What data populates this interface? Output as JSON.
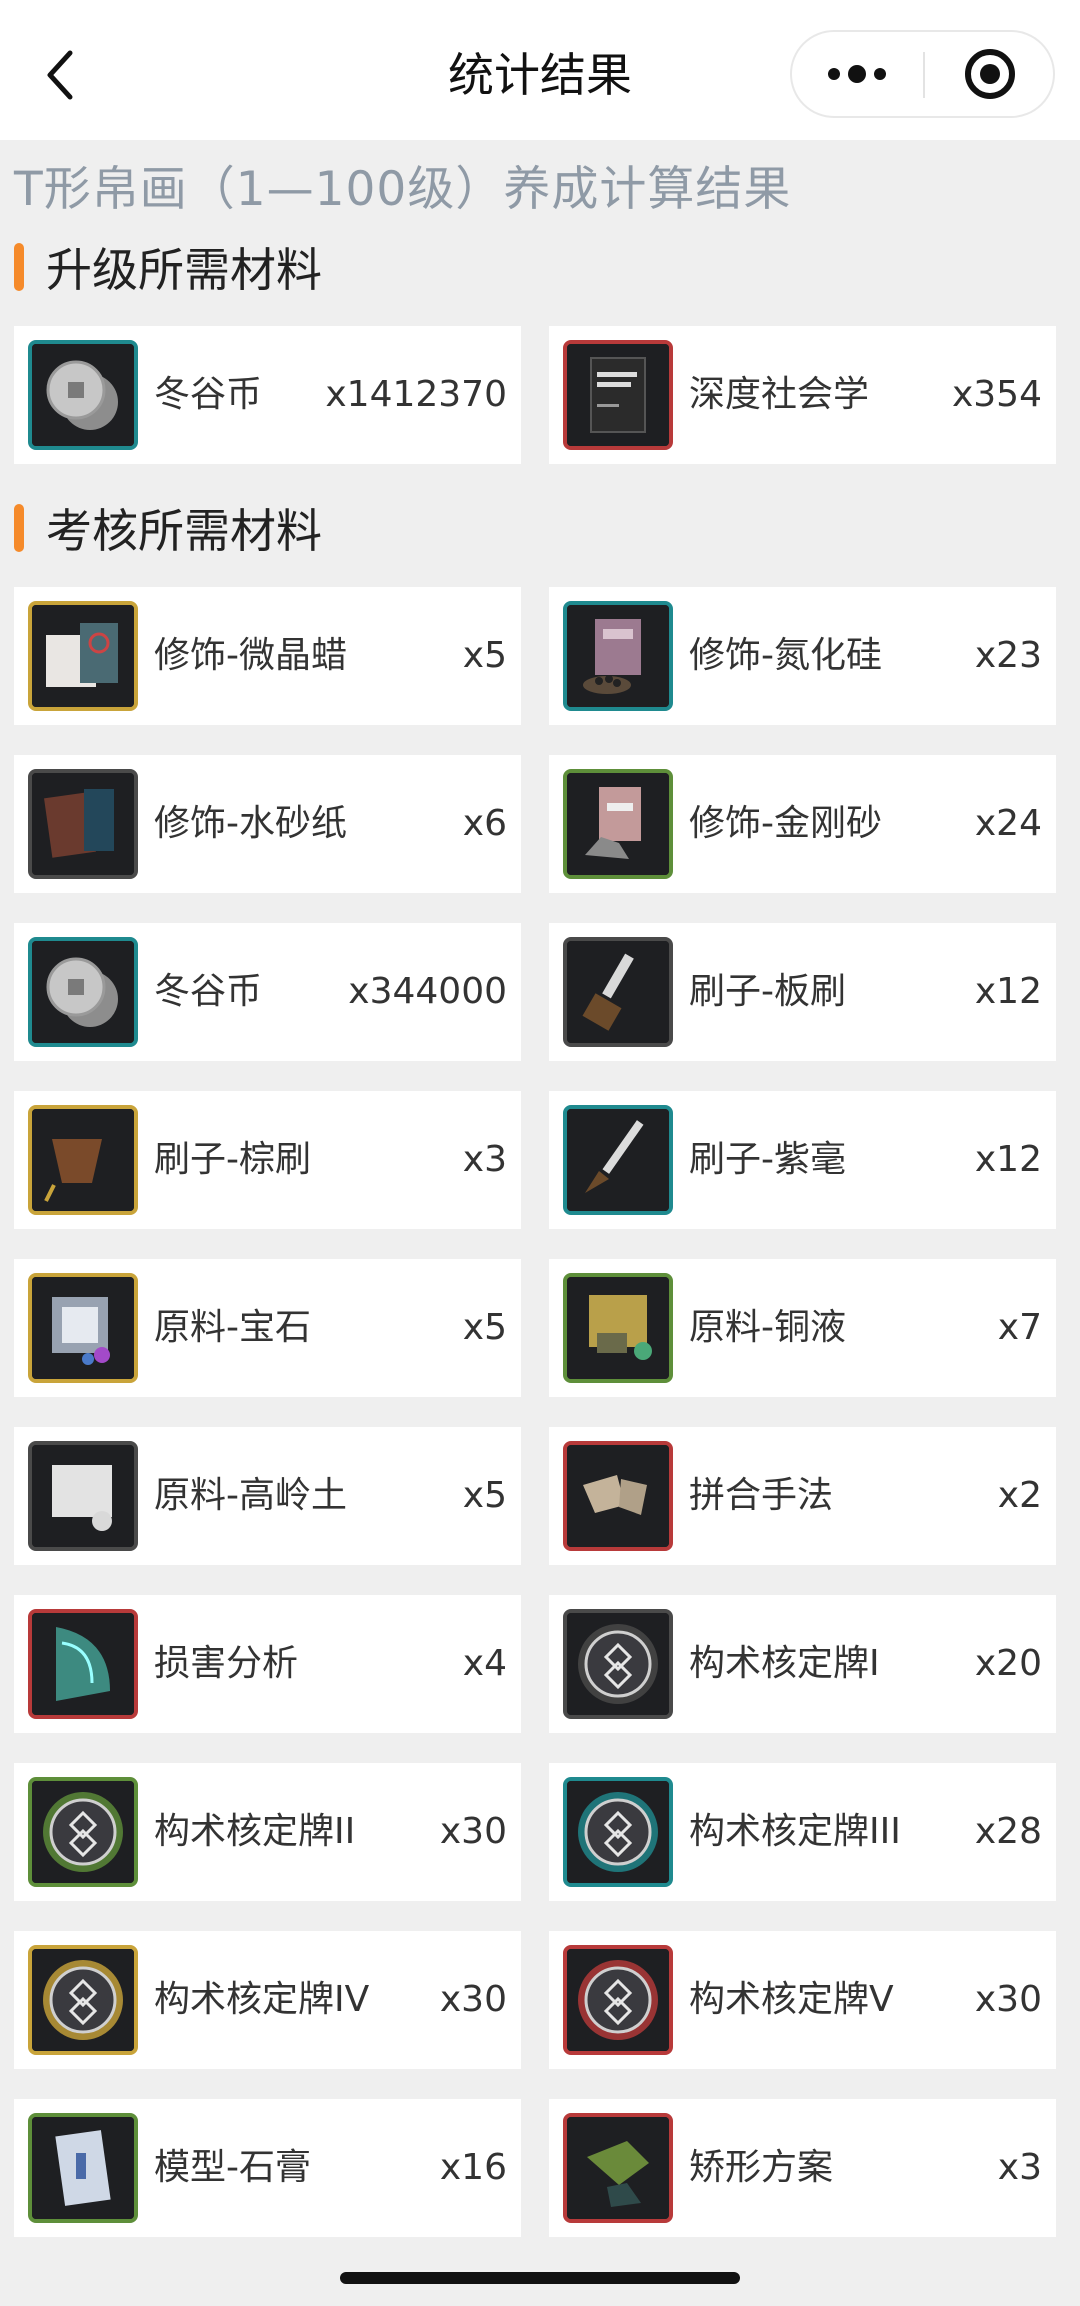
{
  "nav": {
    "title": "统计结果",
    "back_icon": "chevron-left-icon",
    "more_icon": "more-dots-icon",
    "close_icon": "target-close-icon"
  },
  "page_heading": "T形帛画（1—100级）养成计算结果",
  "colors": {
    "accent": "#f58a2a",
    "heading": "#8f9aa6",
    "frame_gold": "#c9a43a",
    "frame_teal": "#1f8a8f",
    "frame_red": "#b83a3a",
    "frame_green": "#5e8f3a",
    "frame_gray": "#4a4a4a"
  },
  "sections": [
    {
      "title": "升级所需材料",
      "items": [
        {
          "name": "冬谷币",
          "qty": "x1412370",
          "frame": "teal",
          "icon": "coin-icon"
        },
        {
          "name": "深度社会学",
          "qty": "x354",
          "frame": "red",
          "icon": "book-icon"
        }
      ]
    },
    {
      "title": "考核所需材料",
      "items": [
        {
          "name": "修饰-微晶蜡",
          "qty": "x5",
          "frame": "gold",
          "icon": "wax-box-icon"
        },
        {
          "name": "修饰-氮化硅",
          "qty": "x23",
          "frame": "teal",
          "icon": "powder-bag-icon"
        },
        {
          "name": "修饰-水砂纸",
          "qty": "x6",
          "frame": "gray",
          "icon": "sandpaper-icon"
        },
        {
          "name": "修饰-金刚砂",
          "qty": "x24",
          "frame": "green",
          "icon": "emery-bag-icon"
        },
        {
          "name": "冬谷币",
          "qty": "x344000",
          "frame": "teal",
          "icon": "coin-icon"
        },
        {
          "name": "刷子-板刷",
          "qty": "x12",
          "frame": "gray",
          "icon": "flat-brush-icon"
        },
        {
          "name": "刷子-棕刷",
          "qty": "x3",
          "frame": "gold",
          "icon": "palm-brush-icon"
        },
        {
          "name": "刷子-紫毫",
          "qty": "x12",
          "frame": "teal",
          "icon": "purple-brush-icon"
        },
        {
          "name": "原料-宝石",
          "qty": "x5",
          "frame": "gold",
          "icon": "gem-cube-icon"
        },
        {
          "name": "原料-铜液",
          "qty": "x7",
          "frame": "green",
          "icon": "copper-liquid-icon"
        },
        {
          "name": "原料-高岭土",
          "qty": "x5",
          "frame": "gray",
          "icon": "kaolin-icon"
        },
        {
          "name": "拼合手法",
          "qty": "x2",
          "frame": "red",
          "icon": "fragments-icon"
        },
        {
          "name": "损害分析",
          "qty": "x4",
          "frame": "red",
          "icon": "scan-icon"
        },
        {
          "name": "构术核定牌I",
          "qty": "x20",
          "frame": "gray",
          "icon": "medal-icon"
        },
        {
          "name": "构术核定牌II",
          "qty": "x30",
          "frame": "green",
          "icon": "medal-icon"
        },
        {
          "name": "构术核定牌III",
          "qty": "x28",
          "frame": "teal",
          "icon": "medal-icon"
        },
        {
          "name": "构术核定牌IV",
          "qty": "x30",
          "frame": "gold",
          "icon": "medal-icon"
        },
        {
          "name": "构术核定牌V",
          "qty": "x30",
          "frame": "red",
          "icon": "medal-icon"
        },
        {
          "name": "模型-石膏",
          "qty": "x16",
          "frame": "green",
          "icon": "plaster-model-icon"
        },
        {
          "name": "矫形方案",
          "qty": "x3",
          "frame": "red",
          "icon": "correction-plan-icon"
        }
      ]
    }
  ]
}
